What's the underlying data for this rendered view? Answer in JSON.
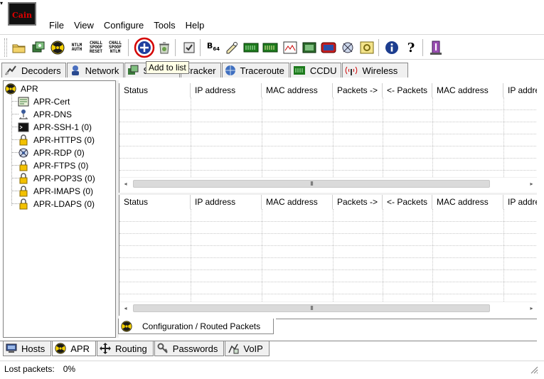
{
  "app": {
    "logo_text": "Cain",
    "system_menu_glyph": "▾"
  },
  "menu": {
    "items": [
      "File",
      "View",
      "Configure",
      "Tools",
      "Help"
    ]
  },
  "toolbar": {
    "buttons": [
      {
        "name": "open-icon"
      },
      {
        "name": "start-sniffer-icon"
      },
      {
        "name": "start-apr-icon"
      },
      {
        "name": "ntlm-auth-icon",
        "text": "NTLM AUTH"
      },
      {
        "name": "chall-spoof-reset-icon",
        "text": "CHALL SPOOF RESET"
      },
      {
        "name": "chall-spoof-ntlm-icon",
        "text": "CHALL SPOOF NTLM"
      },
      {
        "name": "add-to-list-icon"
      },
      {
        "name": "remove-from-list-icon"
      },
      {
        "name": "test-password-icon"
      },
      {
        "name": "base64-icon",
        "text": "B64"
      },
      {
        "name": "hash-calculator-icon"
      },
      {
        "name": "winrm-icon"
      },
      {
        "name": "mrd-icon"
      },
      {
        "name": "decoder-icon"
      },
      {
        "name": "terminal-icon"
      },
      {
        "name": "monitor-icon"
      },
      {
        "name": "network-node-icon"
      },
      {
        "name": "certificate-icon"
      },
      {
        "name": "info-icon"
      },
      {
        "name": "help-icon"
      },
      {
        "name": "exit-icon"
      }
    ],
    "tooltip": "Add to list"
  },
  "tabs": {
    "items": [
      "Decoders",
      "Network",
      "S",
      "Cracker",
      "Traceroute",
      "CCDU",
      "Wireless"
    ]
  },
  "tree": {
    "root": "APR",
    "items": [
      {
        "label": "APR-Cert",
        "icon": "certificate-icon"
      },
      {
        "label": "APR-DNS",
        "icon": "dns-icon"
      },
      {
        "label": "APR-SSH-1 (0)",
        "icon": "terminal-icon"
      },
      {
        "label": "APR-HTTPS (0)",
        "icon": "lock-icon"
      },
      {
        "label": "APR-RDP (0)",
        "icon": "rdp-icon"
      },
      {
        "label": "APR-FTPS (0)",
        "icon": "lock-icon"
      },
      {
        "label": "APR-POP3S (0)",
        "icon": "lock-icon"
      },
      {
        "label": "APR-IMAPS (0)",
        "icon": "lock-icon"
      },
      {
        "label": "APR-LDAPS (0)",
        "icon": "lock-icon"
      }
    ]
  },
  "table_top": {
    "columns": [
      "Status",
      "IP address",
      "MAC address",
      "Packets ->",
      "<- Packets",
      "MAC address",
      "IP address"
    ],
    "rows": []
  },
  "table_bottom": {
    "columns": [
      "Status",
      "IP address",
      "MAC address",
      "Packets ->",
      "<- Packets",
      "MAC address",
      "IP address"
    ],
    "rows": []
  },
  "scrollbar": {
    "left_arrow": "◂",
    "right_arrow": "▸",
    "thumb_grip": "III"
  },
  "bottom_tab": {
    "label": "Configuration / Routed Packets"
  },
  "main_tabs": {
    "items": [
      "Hosts",
      "APR",
      "Routing",
      "Passwords",
      "VoIP"
    ],
    "active": "APR"
  },
  "status": {
    "label": "Lost packets:",
    "value": "0%"
  },
  "colors": {
    "hazard_yellow": "#f5d000",
    "hazard_black": "#1a1a1a",
    "add_ring_red": "#d40000",
    "add_circle_blue": "#1f3f9f",
    "info_blue": "#1c3d8f",
    "lock_yellow": "#f3c100"
  }
}
